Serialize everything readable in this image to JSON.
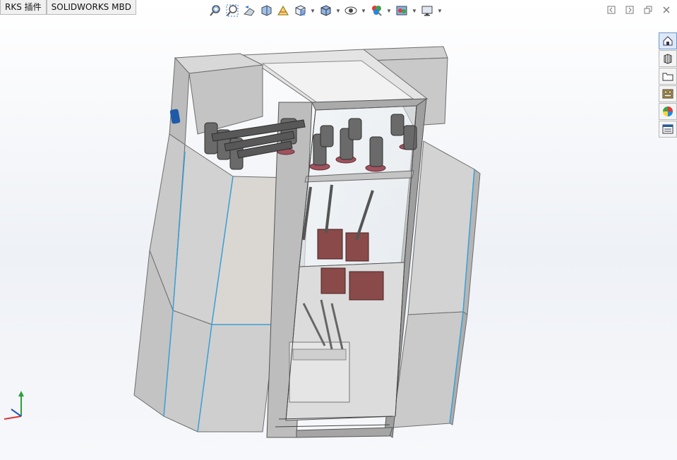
{
  "tabs": [
    {
      "label": "RKS 插件",
      "active": false
    },
    {
      "label": "SOLIDWORKS MBD",
      "active": false
    }
  ],
  "heads_up_toolbar": {
    "icons": [
      "zoom-to-fit-icon",
      "zoom-to-area-icon",
      "previous-view-icon",
      "section-view-icon",
      "dynamic-annotation-icon",
      "view-orientation-icon",
      "display-style-icon",
      "hide-show-items-icon",
      "edit-appearance-icon",
      "apply-scene-icon",
      "view-settings-icon"
    ]
  },
  "window_controls": {
    "icons": [
      "restore-left-icon",
      "restore-right-icon",
      "restore-window-icon",
      "close-icon"
    ]
  },
  "task_pane": {
    "icons": [
      "solidworks-resources-icon",
      "design-library-icon",
      "file-explorer-icon",
      "view-palette-icon",
      "appearances-scenes-icon",
      "custom-properties-icon"
    ],
    "active_index": 0
  },
  "colors": {
    "panel_light": "#dcdcdc",
    "panel_mid": "#c8c8c8",
    "panel_dark": "#a9a9a9",
    "edge_blue": "#3aa0d8",
    "bushing_red": "#a0525e",
    "cable_dark": "#4a4a4a",
    "ct_red": "#8a4a4a",
    "frame_grey": "#9a9a9a"
  },
  "triad": {
    "axes": [
      "x",
      "y",
      "z"
    ]
  }
}
